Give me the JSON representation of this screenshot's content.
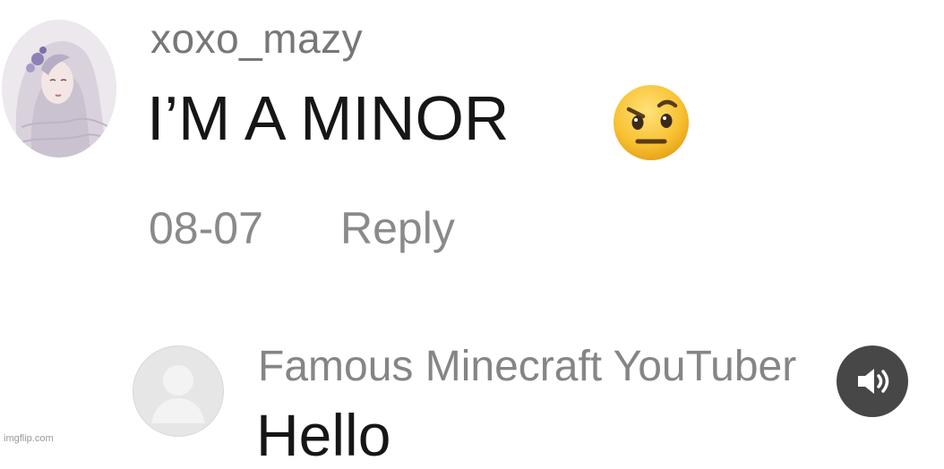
{
  "comments": [
    {
      "username": "xoxo_mazy",
      "text": "I’M A MINOR",
      "emoji": "face-with-raised-eyebrow-icon",
      "date": "08-07",
      "reply_label": "Reply"
    },
    {
      "username": "Famous Minecraft YouTuber",
      "text": "Hello"
    }
  ],
  "watermark": "imgflip.com",
  "colors": {
    "background": "#ffffff",
    "username": "#777777",
    "body_text": "#161616",
    "meta": "#8a8a8a",
    "sound_button": "#3a3a3a"
  },
  "icons": {
    "sound": "speaker-volume-icon",
    "avatar_placeholder": "default-avatar-icon"
  }
}
